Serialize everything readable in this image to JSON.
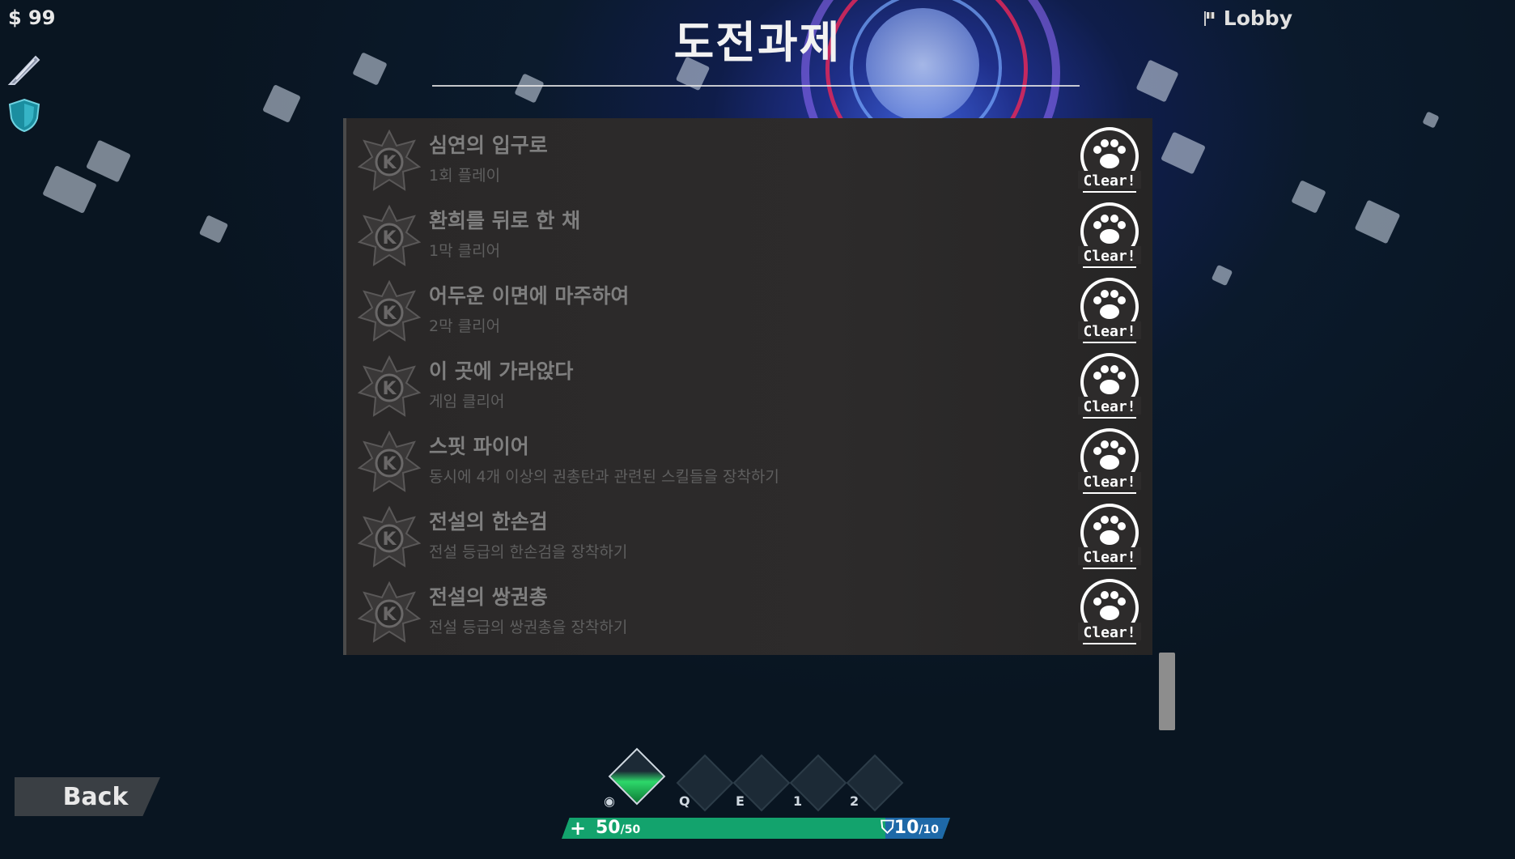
{
  "hud": {
    "money": "$ 99",
    "lobby": "Lobby"
  },
  "header": {
    "title": "도전과제"
  },
  "achievements": [
    {
      "name": "심연의 입구로",
      "desc": "1회 플레이",
      "status": "Clear!"
    },
    {
      "name": "환희를 뒤로 한 채",
      "desc": "1막 클리어",
      "status": "Clear!"
    },
    {
      "name": "어두운 이면에 마주하여",
      "desc": "2막 클리어",
      "status": "Clear!"
    },
    {
      "name": "이 곳에 가라앉다",
      "desc": "게임 클리어",
      "status": "Clear!"
    },
    {
      "name": "스핏 파이어",
      "desc": "동시에 4개 이상의 권총탄과 관련된 스킬들을 장착하기",
      "status": "Clear!"
    },
    {
      "name": "전설의 한손검",
      "desc": "전설 등급의 한손검을 장착하기",
      "status": "Clear!"
    },
    {
      "name": "전설의 쌍권총",
      "desc": "전설 등급의 쌍권총을 장착하기",
      "status": "Clear!"
    }
  ],
  "back_label": "Back",
  "skills": {
    "keys": [
      "Q",
      "E",
      "1",
      "2"
    ]
  },
  "status": {
    "hp_current": "50",
    "hp_max": "/50",
    "armor_current": "10",
    "armor_max": "/10"
  },
  "colors": {
    "hp": "#13a36d",
    "armor": "#1e69a8",
    "accent_ring": "#e0285a"
  }
}
